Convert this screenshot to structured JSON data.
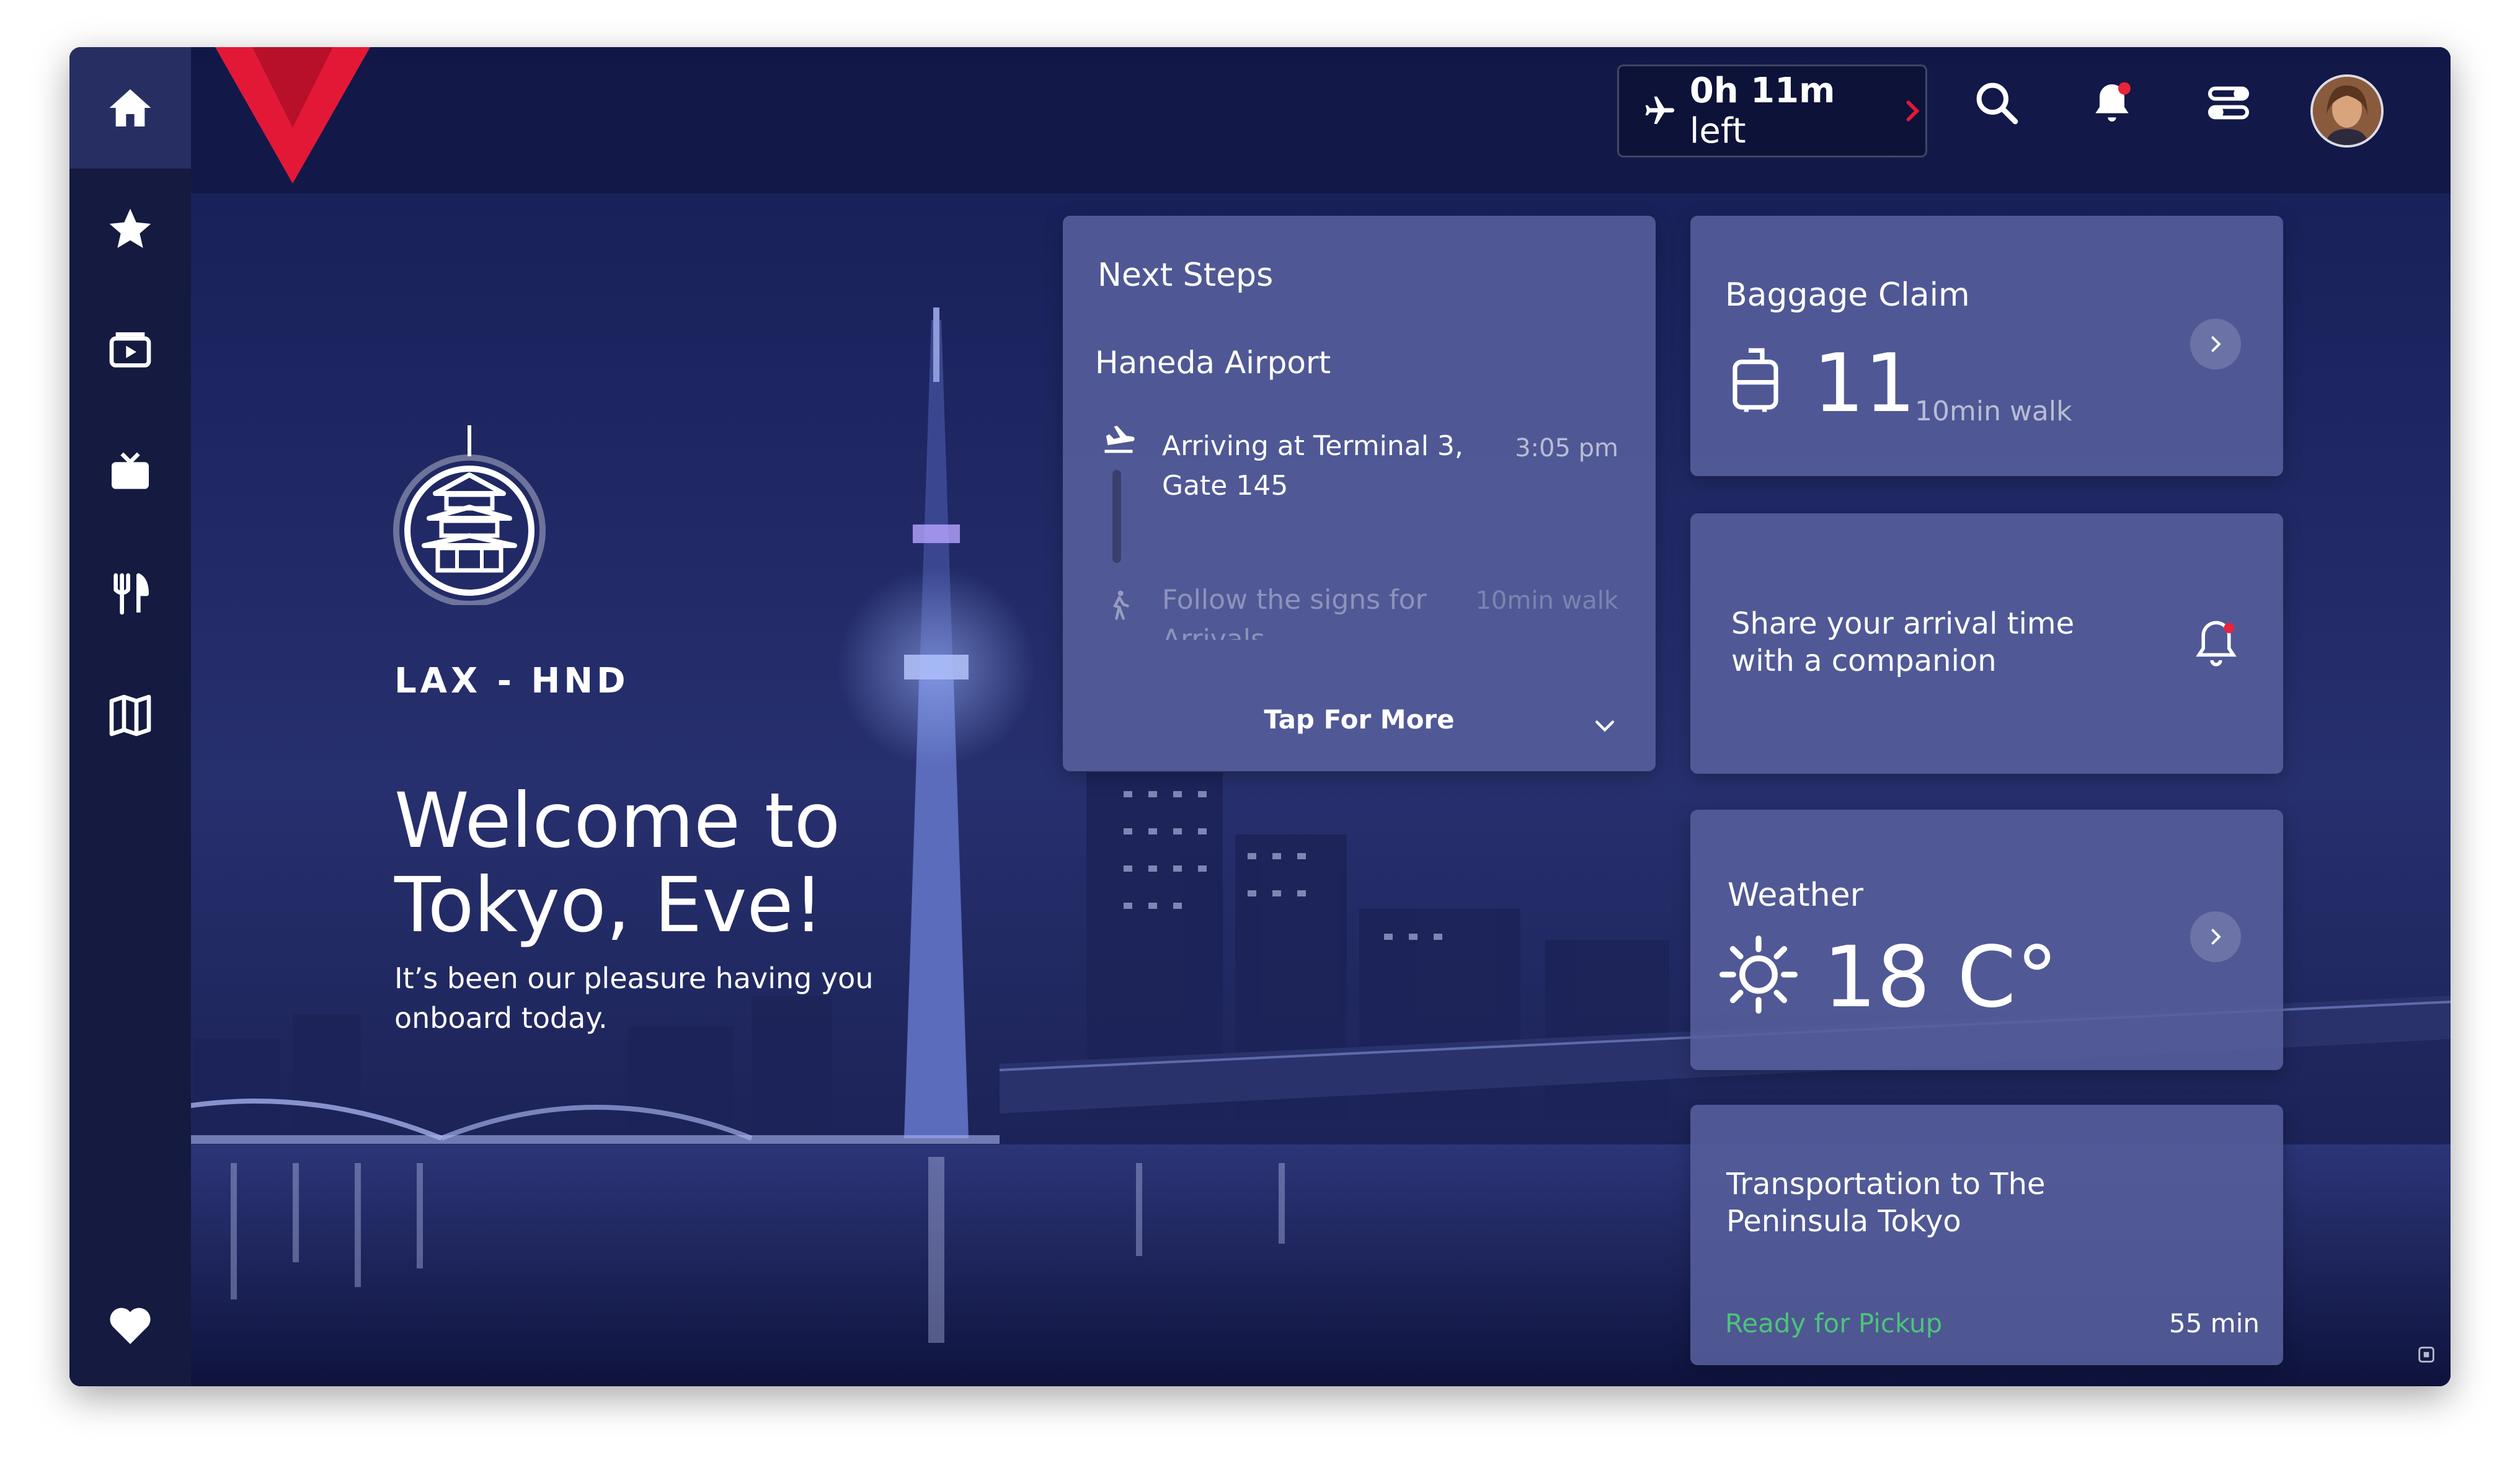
{
  "sidebar": {
    "items": [
      {
        "name": "home",
        "icon": "home-icon"
      },
      {
        "name": "favorites",
        "icon": "star-icon"
      },
      {
        "name": "movies",
        "icon": "movie-ticket-icon"
      },
      {
        "name": "tv",
        "icon": "tv-icon"
      },
      {
        "name": "dining",
        "icon": "utensils-icon"
      },
      {
        "name": "map",
        "icon": "map-icon"
      },
      {
        "name": "wellness",
        "icon": "heart-icon"
      }
    ]
  },
  "header": {
    "time_value": "0h 11m",
    "time_suffix": "left"
  },
  "hero": {
    "route": "LAX - HND",
    "welcome": "Welcome to Tokyo, Eve!",
    "subtitle": "It’s been our pleasure having you onboard today."
  },
  "next_steps": {
    "title": "Next Steps",
    "location": "Haneda Airport",
    "steps": [
      {
        "text": "Arriving at Terminal 3, Gate 145",
        "meta": "3:05 pm"
      },
      {
        "text": "Follow the signs for Arrivals",
        "meta": "10min walk"
      }
    ],
    "more_label": "Tap For More"
  },
  "baggage": {
    "title": "Baggage Claim",
    "number": "11",
    "walk": "10min walk"
  },
  "share": {
    "text": "Share your arrival time with a companion"
  },
  "weather": {
    "title": "Weather",
    "temp": "18 C°"
  },
  "transport": {
    "title": "Transportation to The Peninsula Tokyo",
    "status": "Ready for Pickup",
    "eta": "55 min"
  },
  "colors": {
    "accent_red": "#e31837",
    "status_green": "#4cc47a",
    "notification_dot": "#e8243c"
  }
}
